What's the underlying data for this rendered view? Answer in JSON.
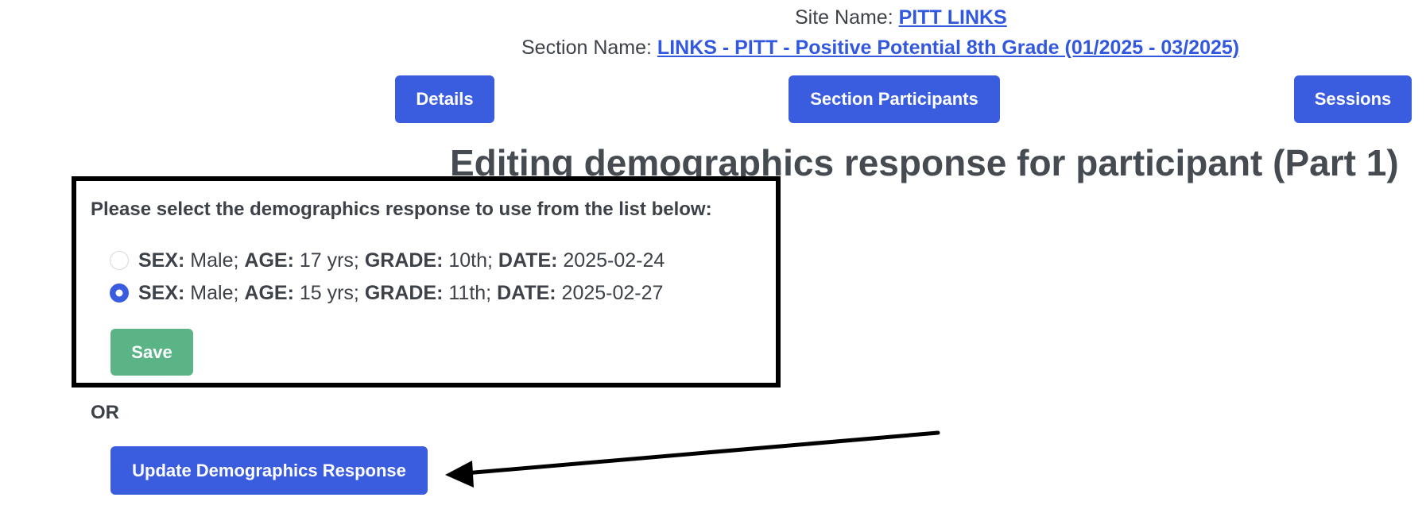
{
  "header": {
    "site_label": "Site Name:",
    "site_name": "PITT LINKS",
    "section_label": "Section Name:",
    "section_name": "LINKS - PITT - Positive Potential 8th Grade (01/2025 - 03/2025)"
  },
  "nav": {
    "details": "Details",
    "section_participants": "Section Participants",
    "sessions": "Sessions"
  },
  "page_title": "Editing demographics response for participant (Part 1)",
  "form": {
    "prompt": "Please select the demographics response to use from the list below:",
    "options": [
      {
        "selected": false,
        "sex_label": "SEX:",
        "sex": " Male; ",
        "age_label": "AGE:",
        "age": " 17 yrs; ",
        "grade_label": "GRADE:",
        "grade": " 10th; ",
        "date_label": "DATE:",
        "date": " 2025-02-24"
      },
      {
        "selected": true,
        "sex_label": "SEX:",
        "sex": " Male; ",
        "age_label": "AGE:",
        "age": " 15 yrs; ",
        "grade_label": "GRADE:",
        "grade": " 11th; ",
        "date_label": "DATE:",
        "date": " 2025-02-27"
      }
    ],
    "save_label": "Save"
  },
  "or_label": "OR",
  "update_label": "Update Demographics Response",
  "colors": {
    "primary": "#3a5de0",
    "save": "#5ab485",
    "link": "#3358e0",
    "annotation": "#000000"
  }
}
